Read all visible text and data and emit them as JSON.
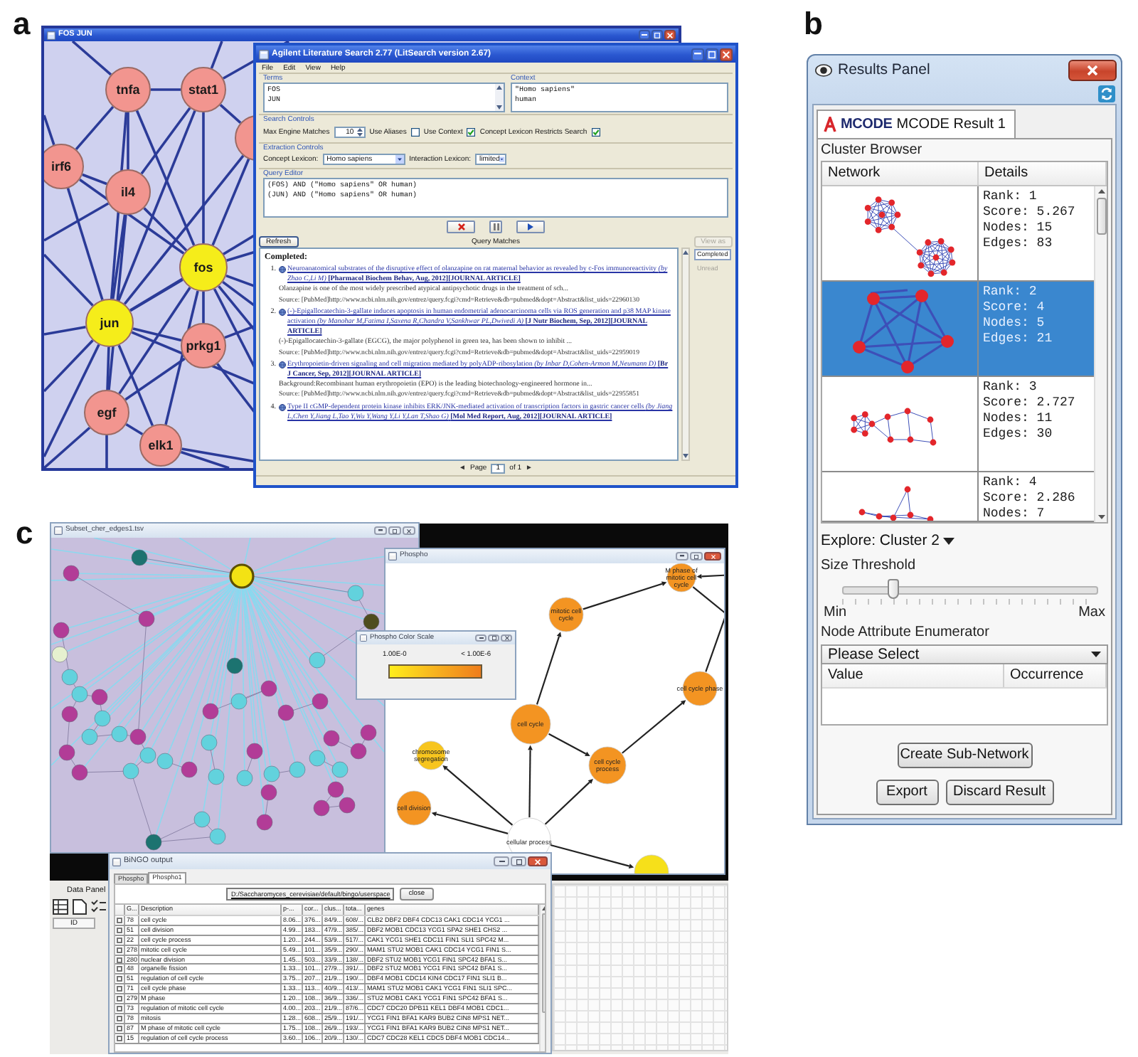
{
  "panel_a": {
    "label": "a",
    "network_window": {
      "title": "FOS JUN",
      "nodes": [
        {
          "label": "tnfa",
          "color": "#f2958f"
        },
        {
          "label": "stat1",
          "color": "#f2958f"
        },
        {
          "label": "irf6",
          "color": "#f2958f"
        },
        {
          "label": "il4",
          "color": "#f2958f"
        },
        {
          "label": "fos",
          "color": "#f5ed1a"
        },
        {
          "label": "jun",
          "color": "#f5ed1a"
        },
        {
          "label": "prkg1",
          "color": "#f2958f"
        },
        {
          "label": "egf",
          "color": "#f2958f"
        },
        {
          "label": "elk1",
          "color": "#f2958f"
        }
      ]
    },
    "literature_window": {
      "title": "Agilent Literature Search 2.77 (LitSearch version 2.67)",
      "menu": [
        "File",
        "Edit",
        "View",
        "Help"
      ],
      "terms": {
        "label": "Terms",
        "lines": [
          "FOS",
          "JUN"
        ]
      },
      "context": {
        "label": "Context",
        "lines": [
          "\"Homo sapiens\"",
          "human"
        ]
      },
      "search_controls": {
        "label": "Search Controls",
        "max_matches_label": "Max Engine Matches",
        "max_matches_value": "10",
        "checkboxes": [
          {
            "label": "Use Aliases",
            "checked": false
          },
          {
            "label": "Use Context",
            "checked": true
          },
          {
            "label": "Concept Lexicon Restricts Search",
            "checked": true
          }
        ]
      },
      "extraction_controls": {
        "label": "Extraction Controls",
        "fields": [
          {
            "label": "Concept Lexicon:",
            "value": "Homo sapiens"
          },
          {
            "label": "Interaction Lexicon:",
            "value": "limited"
          }
        ]
      },
      "query_editor": {
        "label": "Query Editor",
        "lines": [
          "(FOS) AND (\"Homo sapiens\" OR human)",
          "(JUN) AND (\"Homo sapiens\" OR human)"
        ]
      },
      "refresh_button": "Refresh",
      "matches_title": "Query Matches",
      "view_button": {
        "label": "View as",
        "disabled": true
      },
      "results": {
        "heading": "Completed:",
        "items": [
          {
            "number": "1.",
            "title": "Neuroanatomical substrates of the disruptive effect of olanzapine on rat maternal behavior as revealed by c-Fos immunoreactivity *(by Zhao C,Li M)* **[Pharmacol Biochem Behav, Aug, 2012][JOURNAL ARTICLE]**",
            "abstract": "Olanzapine is one of the most widely prescribed atypical antipsychotic drugs in the treatment of sch...",
            "source": "Source: [PubMed]http://www.ncbi.nlm.nih.gov/entrez/query.fcgi?cmd=Retrieve&db=pubmed&dopt=Abstract&list_uids=22960130"
          },
          {
            "number": "2.",
            "title": "(-)-Epigallocatechin-3-gallate induces apoptosis in human endometrial adenocarcinoma cells via ROS generation and p38 MAP kinase activation *(by Manohar M,Fatima I,Saxena R,Chandra V,Sankhwar PL,Dwivedi A)* **[J Nutr Biochem, Sep, 2012][JOURNAL ARTICLE]**",
            "abstract": "(-)-Epigallocatechin-3-gallate (EGCG), the major polyphenol in green tea, has been shown to inhibit ...",
            "source": "Source: [PubMed]http://www.ncbi.nlm.nih.gov/entrez/query.fcgi?cmd=Retrieve&db=pubmed&dopt=Abstract&list_uids=22959019"
          },
          {
            "number": "3.",
            "title": "Erythropoietin-driven signaling and cell migration mediated by polyADP-ribosylation *(by Inbar D,Cohen-Armon M,Neumann D)* **[Br J Cancer, Sep, 2012][JOURNAL ARTICLE]**",
            "abstract": "Background:Recombinant human erythropoietin (EPO) is the leading biotechnology-engineered hormone in...",
            "source": "Source: [PubMed]http://www.ncbi.nlm.nih.gov/entrez/query.fcgi?cmd=Retrieve&db=pubmed&dopt=Abstract&list_uids=22955851"
          },
          {
            "number": "4.",
            "title": "Type II cGMP-dependent protein kinase inhibits ERK/JNK-mediated activation of transcription factors in gastric cancer cells *(by Jiang L,Chen Y,Jiang L,Tao Y,Wu Y,Wang Y,Li Y,Lan T,Shao G)* **[Mol Med Report, Aug, 2012][JOURNAL ARTICLE]**"
          }
        ]
      },
      "status_list": [
        {
          "label": "Completed",
          "selected": true
        },
        {
          "label": "Unread",
          "selected": false
        }
      ],
      "pager": {
        "prev": "◄",
        "label": "Page",
        "value": "1",
        "total": "of 1",
        "next": "►"
      }
    }
  },
  "panel_b": {
    "label": "b",
    "results_panel": {
      "title": "Results Panel",
      "tabs": [
        {
          "logo": "MCODE",
          "label": "MCODE Result 1",
          "selected": true
        }
      ],
      "cluster_browser": {
        "label": "Cluster Browser",
        "columns": [
          "Network",
          "Details"
        ],
        "rows": [
          {
            "details": [
              "Rank: 1",
              "Score: 5.267",
              "Nodes: 15",
              "Edges: 83"
            ],
            "selected": false
          },
          {
            "details": [
              "Rank: 2",
              "Score: 4",
              "Nodes: 5",
              "Edges: 21"
            ],
            "selected": true
          },
          {
            "details": [
              "Rank: 3",
              "Score: 2.727",
              "Nodes: 11",
              "Edges: 30"
            ],
            "selected": false
          },
          {
            "details": [
              "Rank: 4",
              "Score: 2.286",
              "Nodes: 7"
            ],
            "selected": false
          }
        ]
      },
      "explore": "Explore: Cluster 2",
      "size_threshold": {
        "label": "Size Threshold",
        "level": 0.2,
        "min": "Min",
        "max": "Max"
      },
      "attribute_enumerator": {
        "label": "Node Attribute Enumerator",
        "select": "Please Select",
        "columns": [
          "Value",
          "Occurrence"
        ]
      },
      "create_button": "Create Sub-Network",
      "bottom_buttons": [
        "Export",
        "Discard Result"
      ]
    }
  },
  "panel_c": {
    "label": "c",
    "network_window": {
      "title": "Subset_cher_edges1.tsv"
    },
    "phospho_window": {
      "title": "Phospho",
      "nodes": [
        {
          "label": "M phase of mitotic cell cycle",
          "color": "#f39422"
        },
        {
          "label": "mitotic cell cycle",
          "color": "#f39422"
        },
        {
          "label": "cell cycle phase",
          "color": "#f39422"
        },
        {
          "label": "cell cycle",
          "color": "#f39422"
        },
        {
          "label": "cell cycle process",
          "color": "#f39422"
        },
        {
          "label": "chromosome segregation",
          "color": "#f7c51e"
        },
        {
          "label": "cell division",
          "color": "#f39422"
        },
        {
          "label": "cellular process",
          "color": "#ffffff"
        },
        {
          "color": "#f6e01a"
        }
      ]
    },
    "color_scale": {
      "title": "Phospho Color Scale",
      "min_label": "1.00E-0",
      "max_label": "< 1.00E-6"
    },
    "data_panel": {
      "title": "Data Panel",
      "column": "ID"
    },
    "bingo_window": {
      "title": "BiNGO output",
      "tabs": [
        {
          "label": "Phospho",
          "selected": false
        },
        {
          "label": "Phospho1",
          "selected": true
        }
      ],
      "path": "D:/Saccharomyces_cerevisiae/default/bingo/userspace",
      "close_button": "close",
      "columns": [
        "G...",
        "Description",
        "p-...",
        "cor...",
        "clus...",
        "tota...",
        "genes"
      ],
      "rows": [
        {
          "checked": false,
          "cells": [
            "78",
            "cell cycle",
            "8.06...",
            "376...",
            "84/9...",
            "608/...",
            "CLB2 DBF2 DBF4 CDC13 CAK1 CDC14 YCG1 ..."
          ]
        },
        {
          "checked": false,
          "cells": [
            "51",
            "cell division",
            "4.99...",
            "183...",
            "47/9...",
            "385/...",
            "DBF2 MOB1 CDC13 YCG1 SPA2 SHE1 CHS2 ..."
          ]
        },
        {
          "checked": false,
          "cells": [
            "22",
            "cell cycle process",
            "1.20...",
            "244...",
            "53/9...",
            "517/...",
            "CAK1 YCG1 SHE1 CDC11 FIN1 SLI1 SPC42 M..."
          ]
        },
        {
          "checked": false,
          "cells": [
            "278",
            "mitotic cell cycle",
            "5.49...",
            "101...",
            "35/9...",
            "290/...",
            "MAM1 STU2 MOB1 CAK1 CDC14 YCG1 FIN1 S..."
          ]
        },
        {
          "checked": false,
          "cells": [
            "280",
            "nuclear division",
            "1.45...",
            "503...",
            "33/9...",
            "138/...",
            "DBF2 STU2 MOB1 YCG1 FIN1 SPC42 BFA1 S..."
          ]
        },
        {
          "checked": false,
          "cells": [
            "48",
            "organelle fission",
            "1.33...",
            "101...",
            "27/9...",
            "391/...",
            "DBF2 STU2 MOB1 YCG1 FIN1 SPC42 BFA1 S..."
          ]
        },
        {
          "checked": false,
          "cells": [
            "51",
            "regulation of cell cycle",
            "3.75...",
            "207...",
            "21/9...",
            "190/...",
            "DBF4 MOB1 CDC14 KIN4 CDC17 FIN1 SLI1 B..."
          ]
        },
        {
          "checked": false,
          "cells": [
            "71",
            "cell cycle phase",
            "1.33...",
            "113...",
            "40/9...",
            "413/...",
            "MAM1 STU2 MOB1 CAK1 YCG1 FIN1 SLI1 SPC..."
          ]
        },
        {
          "checked": false,
          "cells": [
            "279",
            "M phase",
            "1.20...",
            "108...",
            "36/9...",
            "336/...",
            "STU2 MOB1 CAK1 YCG1 FIN1 SPC42 BFA1 S..."
          ]
        },
        {
          "checked": false,
          "cells": [
            "73",
            "regulation of mitotic cell cycle",
            "4.00...",
            "203...",
            "21/9...",
            "87/6...",
            "CDC7 CDC20 DPB11 KEL1 DBF4 MOB1 CDC1..."
          ]
        },
        {
          "checked": false,
          "cells": [
            "78",
            "mitosis",
            "1.28...",
            "608...",
            "25/9...",
            "191/...",
            "YCG1 FIN1 BFA1 KAR9 BUB2 CIN8 MPS1 NET..."
          ]
        },
        {
          "checked": false,
          "cells": [
            "87",
            "M phase of mitotic cell cycle",
            "1.75...",
            "108...",
            "26/9...",
            "193/...",
            "YCG1 FIN1 BFA1 KAR9 BUB2 CIN8 MPS1 NET..."
          ]
        },
        {
          "checked": false,
          "cells": [
            "15",
            "regulation of cell cycle process",
            "3.60...",
            "106...",
            "20/9...",
            "130/...",
            "CDC7 CDC28 KEL1 CDC5 DBF4 MOB1 CDC14..."
          ]
        }
      ]
    }
  }
}
